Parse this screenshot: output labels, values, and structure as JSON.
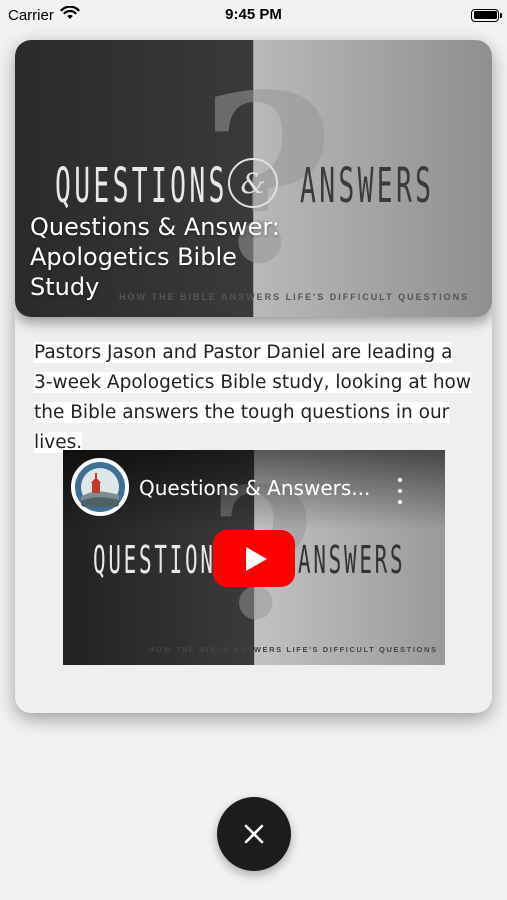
{
  "status_bar": {
    "carrier": "Carrier",
    "time": "9:45 PM",
    "icons": [
      "wifi-icon",
      "battery-icon"
    ]
  },
  "hero": {
    "title": "Questions & Answer: Apologetics Bible Study",
    "graphic_word_left": "QUESTIONS",
    "graphic_ampersand": "&",
    "graphic_word_right": "ANSWERS",
    "graphic_subtitle": "HOW THE BIBLE ANSWERS LIFE'S DIFFICULT QUESTIONS",
    "graphic_mark": "?"
  },
  "description": "Pastors Jason and Pastor Daniel are leading a 3-week Apologetics Bible study, looking at how the Bible answers the tough questions in our lives.",
  "video": {
    "title": "Questions & Answers...",
    "graphic_word_left": "QUESTIONS",
    "graphic_word_right": "ANSWERS",
    "graphic_subtitle": "HOW THE BIBLE ANSWERS LIFE'S DIFFICULT QUESTIONS",
    "graphic_mark": "?",
    "play_color": "#ff0000",
    "icons": [
      "channel-avatar",
      "more-vertical-icon",
      "play-icon"
    ]
  },
  "close_button": {
    "icon": "close-icon",
    "color": "#1c1c1c"
  }
}
